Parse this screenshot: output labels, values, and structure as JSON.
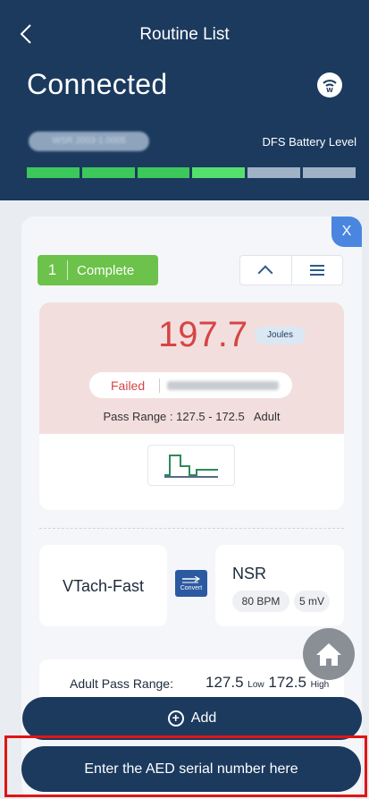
{
  "header": {
    "back_icon": "chevron-left-icon",
    "title": "Routine List",
    "status": "Connected",
    "wifi_icon": "wifi-icon",
    "wifi_glyph": "ʬ",
    "device_serial": "WSR 2003-1.0005",
    "battery_label": "DFS Battery Level",
    "battery_level": 0.7
  },
  "routine": {
    "close_label": "X",
    "number": "1",
    "status": "Complete",
    "energy_value": "197.7",
    "energy_unit": "Joules",
    "result": "Failed",
    "result_timestamp": "2023-01-20 10:45:11",
    "pass_range_text": "Pass Range : 127.5 - 172.5",
    "pass_range_group": "Adult",
    "rhythm_from": "VTach-Fast",
    "convert_label": "Convert",
    "rhythm_to": "NSR",
    "rate": "80 BPM",
    "amplitude": "5 mV",
    "adult_range_label": "Adult Pass Range:",
    "low_value": "127.5",
    "low_label": "Low",
    "high_value": "172.5",
    "high_label": "High"
  },
  "actions": {
    "add_label": "Add",
    "serial_placeholder": "Enter the AED serial number here"
  },
  "colors": {
    "header_bg": "#1b3a5e",
    "fail_red": "#d64545",
    "complete_green": "#6cc24a",
    "highlight_red": "#e01515"
  }
}
